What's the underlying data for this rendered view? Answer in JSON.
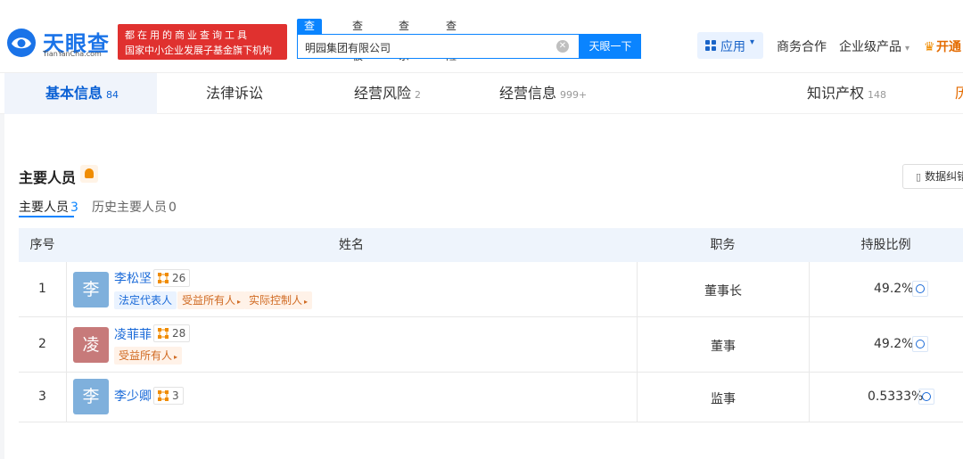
{
  "header": {
    "logo_text": "天眼查",
    "logo_sub": "TianYanCha.com",
    "promo_line1": "都在用的商业查询工具",
    "promo_line2": "国家中小企业发展子基金旗下机构",
    "search_tabs": [
      "查公司",
      "查老板",
      "查关系",
      "查风险"
    ],
    "search_value": "明园集团有限公司",
    "search_button": "天眼一下",
    "apps_label": "应用",
    "nav_business": "商务合作",
    "nav_enterprise": "企业级产品",
    "vip_label": "开通"
  },
  "tabs": [
    {
      "label": "基本信息",
      "count": "84"
    },
    {
      "label": "法律诉讼",
      "count": ""
    },
    {
      "label": "经营风险",
      "count": "2"
    },
    {
      "label": "经营信息",
      "count": "999+"
    },
    {
      "label": "知识产权",
      "count": "148"
    },
    {
      "label": "历",
      "count": ""
    }
  ],
  "section": {
    "title": "主要人员",
    "report_label": "数据纠错",
    "subtabs": [
      {
        "label": "主要人员",
        "count": "3"
      },
      {
        "label": "历史主要人员",
        "count": "0"
      }
    ]
  },
  "table": {
    "headers": [
      "序号",
      "姓名",
      "职务",
      "持股比例"
    ],
    "rows": [
      {
        "index": "1",
        "avatar_char": "李",
        "avatar_color": "#7fb0dc",
        "name": "李松坚",
        "shares": "26",
        "tags": [
          {
            "text": "法定代表人",
            "style": "blue",
            "arrow": ""
          },
          {
            "text": "受益所有人",
            "style": "orange",
            "arrow": "▸"
          },
          {
            "text": "实际控制人",
            "style": "orange",
            "arrow": "▸"
          }
        ],
        "position": "董事长",
        "ratio": "49.2%"
      },
      {
        "index": "2",
        "avatar_char": "凌",
        "avatar_color": "#c77a7a",
        "name": "凌菲菲",
        "shares": "28",
        "tags": [
          {
            "text": "受益所有人",
            "style": "orange",
            "arrow": "▸"
          }
        ],
        "position": "董事",
        "ratio": "49.2%"
      },
      {
        "index": "3",
        "avatar_char": "李",
        "avatar_color": "#7fb0dc",
        "name": "李少卿",
        "shares": "3",
        "tags": [],
        "position": "监事",
        "ratio": "0.5333%"
      }
    ]
  },
  "colors": {
    "brand_blue": "#0a84ff",
    "promo_red": "#e0312f",
    "link_blue": "#1a6ad8",
    "vip_orange": "#e46b00"
  }
}
